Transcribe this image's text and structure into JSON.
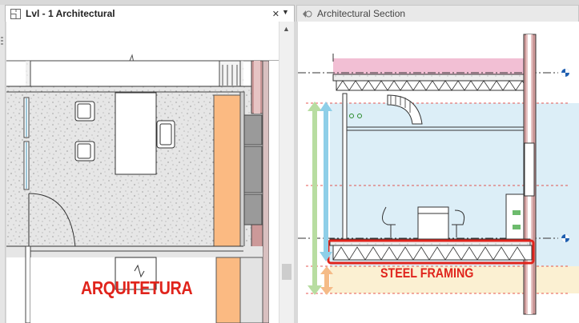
{
  "tabs": {
    "left": {
      "title": "Lvl - 1 Architectural",
      "close": "✕"
    },
    "right": {
      "title": "Architectural Section"
    }
  },
  "dropdown_glyph": "▼",
  "scroll_up_glyph": "▲",
  "labels": {
    "arquitetura": "ARQUITETURA",
    "steel_framing": "STEEL FRAMING"
  },
  "colors": {
    "annotation_red": "#e0241c",
    "concrete_fill": "#e4e4e4",
    "orange_block": "#fbba82",
    "roof_pink": "#f2bfd4",
    "section_blue": "#dceef7",
    "section_beige": "#fbf0d2",
    "green_arrow": "#b8dda1",
    "blue_arrow": "#8fcfe8",
    "orange_arrow": "#f5bb88"
  },
  "icons": {
    "plan_view": "floor-plan-icon",
    "section_view": "section-icon"
  }
}
